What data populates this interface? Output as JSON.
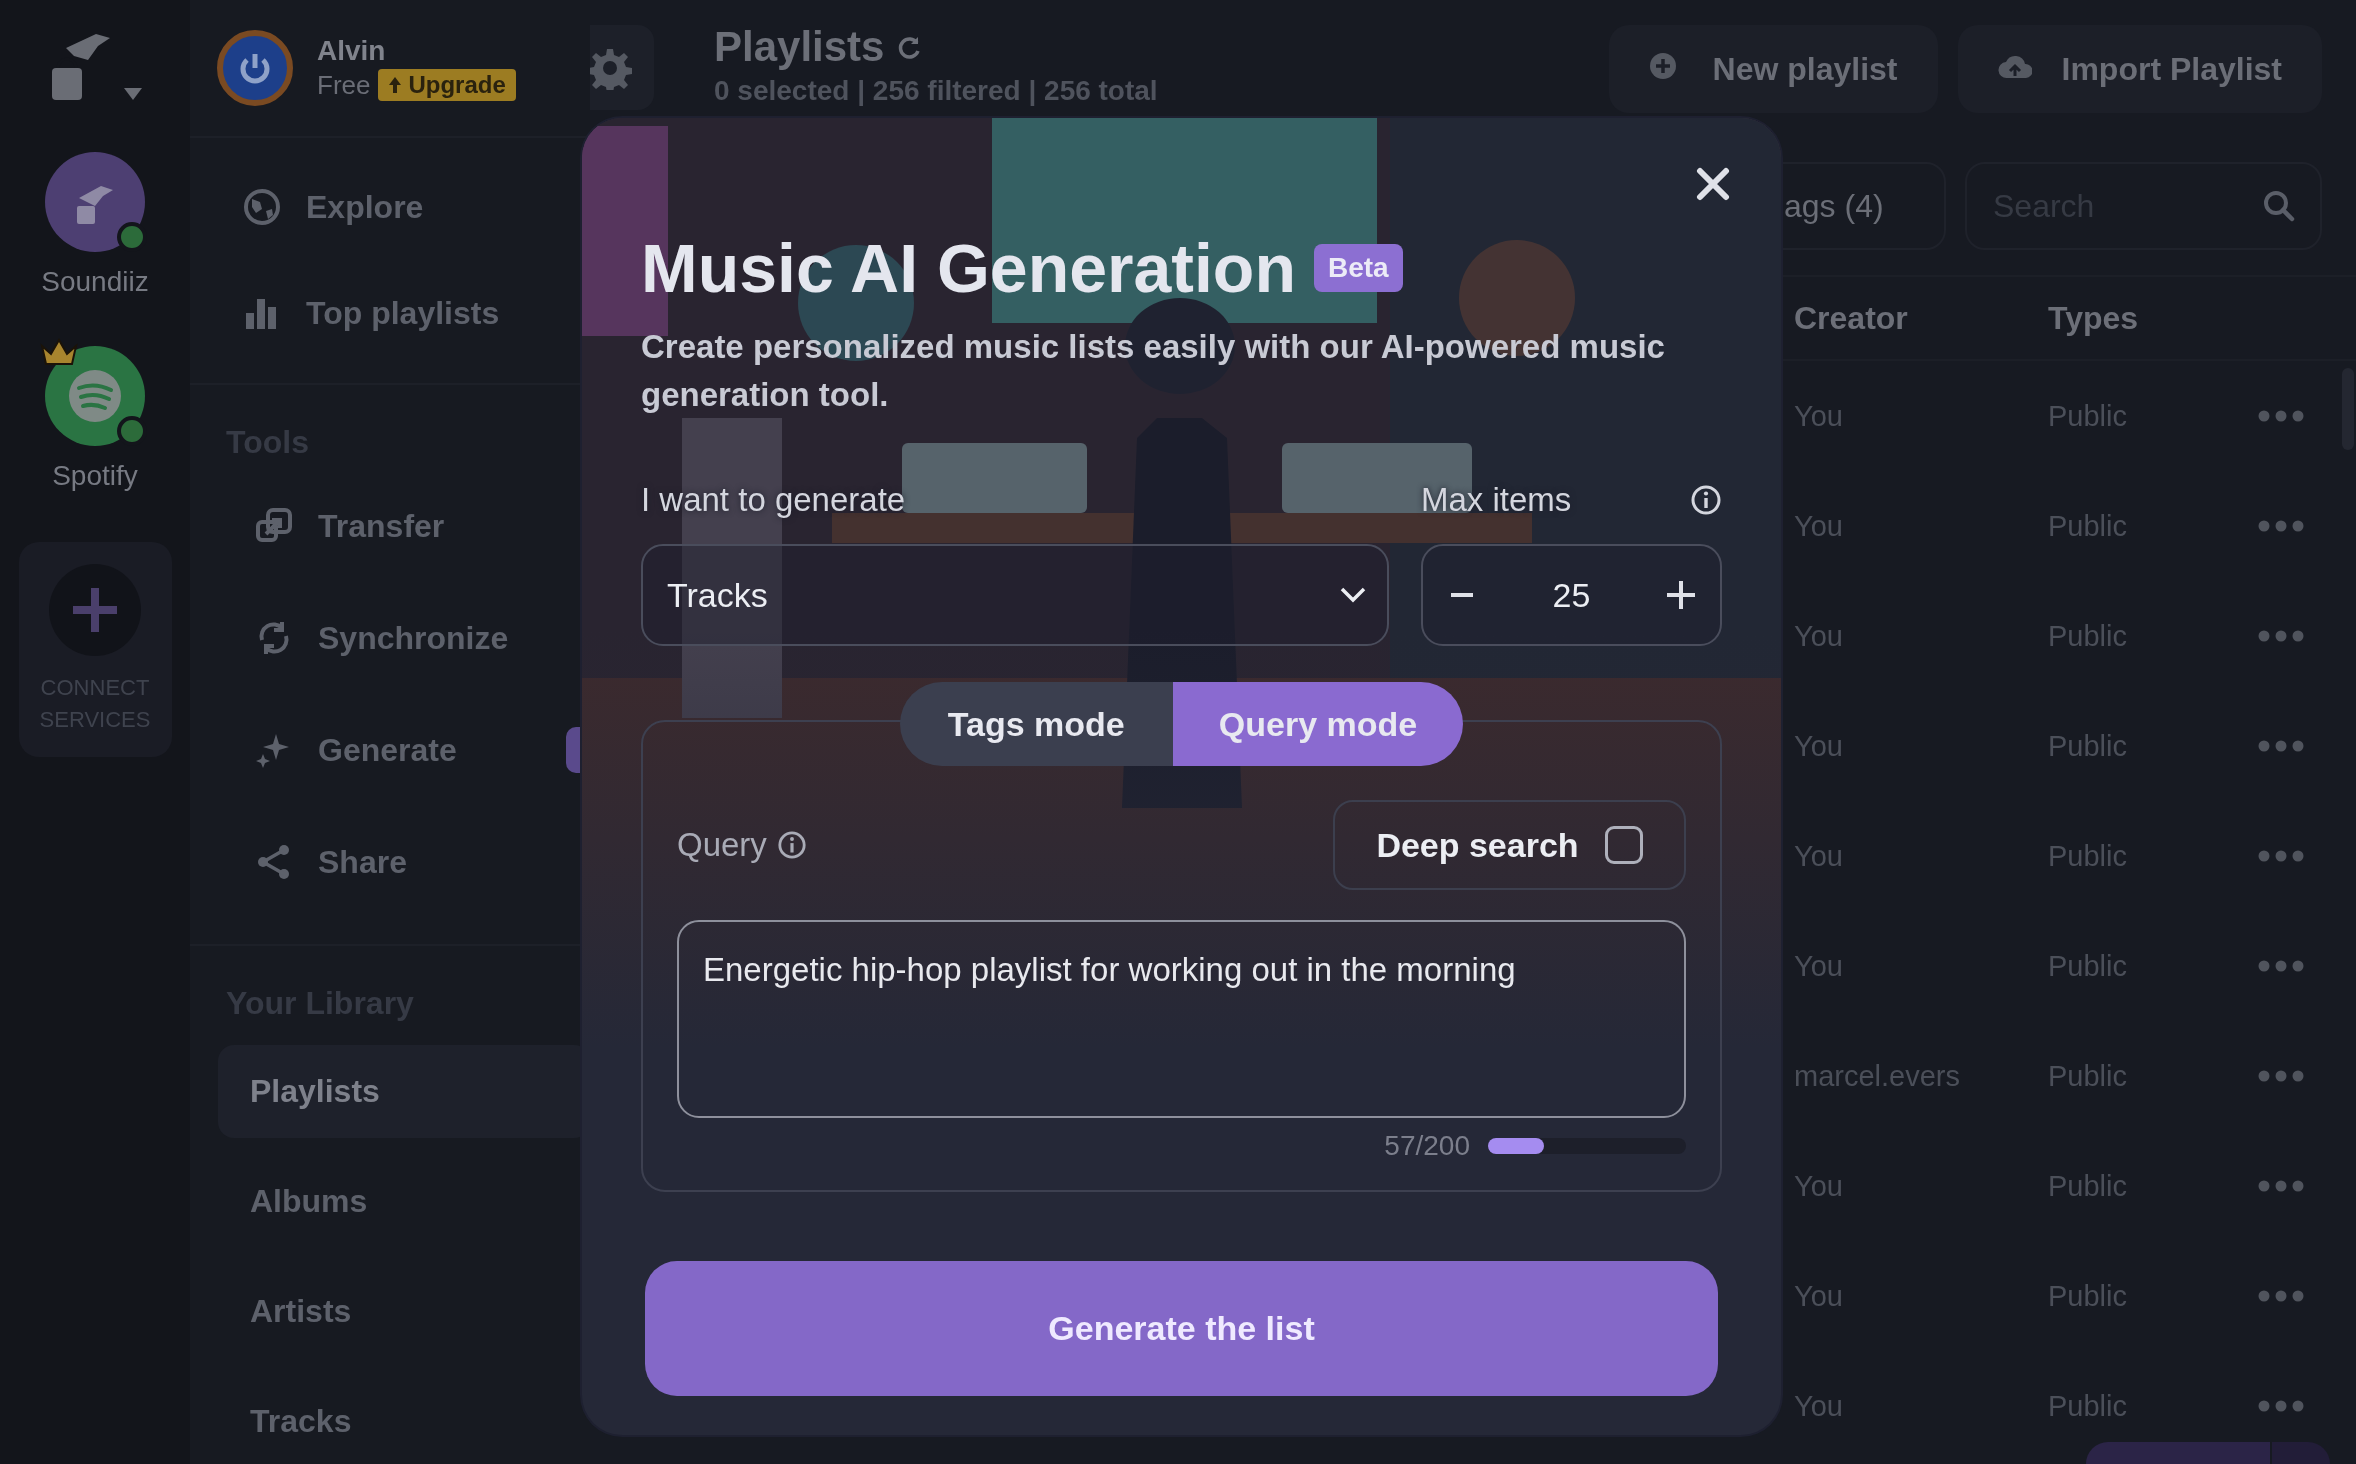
{
  "rail": {
    "services": [
      {
        "name": "Soundiiz",
        "kind": "soundiiz",
        "connected": true,
        "premium": false
      },
      {
        "name": "Spotify",
        "kind": "spotify",
        "connected": true,
        "premium": true
      }
    ],
    "connect": "CONNECT SERVICES"
  },
  "user": {
    "name": "Alvin",
    "plan": "Free",
    "upgrade": "Upgrade"
  },
  "sidebar": {
    "top_items": [
      {
        "label": "Explore",
        "kind": "explore"
      },
      {
        "label": "Top playlists",
        "kind": "top"
      }
    ],
    "sections": [
      {
        "title": "Tools",
        "items": [
          {
            "label": "Transfer",
            "kind": "transfer",
            "badge": false
          },
          {
            "label": "Synchronize",
            "kind": "sync",
            "badge": false
          },
          {
            "label": "Generate",
            "kind": "generate",
            "badge": true
          },
          {
            "label": "Share",
            "kind": "share",
            "badge": false
          }
        ]
      },
      {
        "title": "Your Library",
        "items": [
          {
            "label": "Playlists",
            "selected": true
          },
          {
            "label": "Albums",
            "selected": false
          },
          {
            "label": "Artists",
            "selected": false
          },
          {
            "label": "Tracks",
            "selected": false
          }
        ]
      }
    ]
  },
  "header": {
    "title": "Playlists",
    "subtitle": "0 selected | 256 filtered | 256 total",
    "buttons": [
      {
        "label": "New playlist",
        "kind": "new"
      },
      {
        "label": "Import Playlist",
        "kind": "import"
      }
    ]
  },
  "toolbar": {
    "tags": "ags (4)",
    "search": {
      "placeholder": "Search"
    }
  },
  "table": {
    "columns": [
      "Creator",
      "Types"
    ],
    "rows": [
      {
        "creator": "You",
        "type": "Public"
      },
      {
        "creator": "You",
        "type": "Public"
      },
      {
        "creator": "You",
        "type": "Public"
      },
      {
        "creator": "You",
        "type": "Public"
      },
      {
        "creator": "You",
        "type": "Public"
      },
      {
        "creator": "You",
        "type": "Public"
      },
      {
        "creator": "marcel.evers",
        "type": "Public"
      },
      {
        "creator": "You",
        "type": "Public"
      },
      {
        "creator": "You",
        "type": "Public"
      },
      {
        "creator": "You",
        "type": "Public"
      }
    ]
  },
  "modal": {
    "title": "Music AI Generation",
    "badge": "Beta",
    "description": "Create personalized music lists easily with our AI-powered music generation tool.",
    "generate_label": "I want to generate",
    "generate_value": "Tracks",
    "max_label": "Max items",
    "max_value": "25",
    "modes": [
      {
        "label": "Tags mode",
        "selected": false
      },
      {
        "label": "Query mode",
        "selected": true
      }
    ],
    "query_label": "Query",
    "deep_search": {
      "label": "Deep search",
      "checked": false
    },
    "query": "Energetic hip-hop playlist for working out in the morning",
    "counter": {
      "text": "57/200",
      "level": 0.285
    },
    "submit": "Generate the list"
  }
}
